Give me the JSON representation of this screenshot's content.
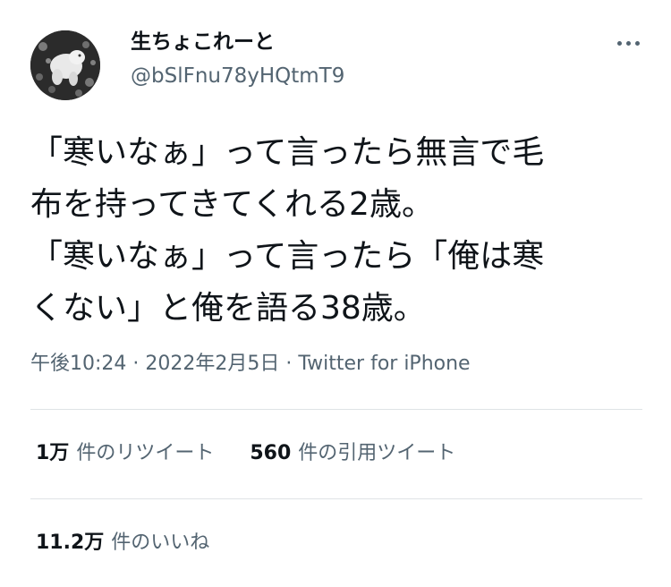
{
  "author": {
    "display_name": "生ちょこれーと",
    "handle": "@bSlFnu78yHQtmT9",
    "avatar_icon": "avatar-photo"
  },
  "tweet": {
    "lines": [
      "「寒いなぁ」って言ったら無言で毛",
      "布を持ってきてくれる2歳。",
      "「寒いなぁ」って言ったら「俺は寒",
      "くない」と俺を語る38歳。"
    ],
    "meta": "午後10:24 · 2022年2月5日 · Twitter for iPhone"
  },
  "stats": {
    "retweets": {
      "value": "1万",
      "label": "件のリツイート"
    },
    "quotes": {
      "value": "560",
      "label": "件の引用ツイート"
    },
    "likes": {
      "value": "11.2万",
      "label": "件のいいね"
    }
  },
  "colors": {
    "text": "#0f1419",
    "secondary": "#536471",
    "divider": "#dfe3e6"
  }
}
